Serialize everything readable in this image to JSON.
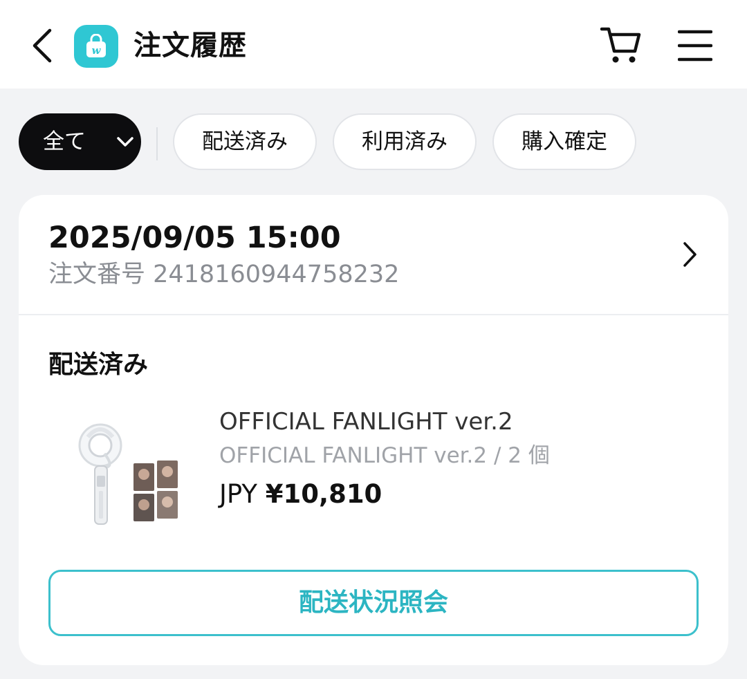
{
  "header": {
    "title": "注文履歴",
    "logo_letter": "w",
    "accent_color": "#2fc7d3",
    "icons": [
      "chevron-left-icon",
      "shopping-bag-icon",
      "cart-icon",
      "hamburger-menu-icon"
    ]
  },
  "filters": {
    "all_label": "全て",
    "chips": [
      "配送済み",
      "利用済み",
      "購入確定"
    ]
  },
  "order": {
    "date": "2025/09/05 15:00",
    "number_label": "注文番号 2418160944758232",
    "status": "配送済み",
    "product": {
      "name": "OFFICIAL FANLIGHT ver.2",
      "option": "OFFICIAL FANLIGHT ver.2 / 2 個",
      "currency": "JPY",
      "price": "¥10,810"
    },
    "track_button": "配送状況照会"
  }
}
